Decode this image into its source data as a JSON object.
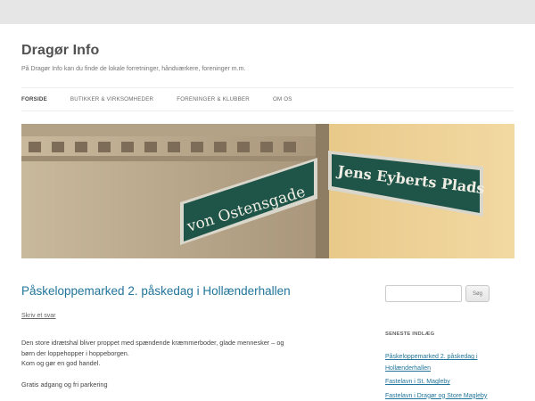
{
  "site": {
    "title": "Dragør Info",
    "description": "På Dragør Info kan du finde de lokale forretninger, håndværkere, foreninger m.m."
  },
  "nav": {
    "items": [
      {
        "label": "FORSIDE",
        "current": true
      },
      {
        "label": "BUTIKKER & VIRKSOMHEDER",
        "current": false
      },
      {
        "label": "FORENINGER & KLUBBER",
        "current": false
      },
      {
        "label": "OM OS",
        "current": false
      }
    ]
  },
  "banner": {
    "sign_left": "von Ostensgade",
    "sign_right": "Jens Eyberts Plads"
  },
  "post": {
    "title": "Påskeloppemarked 2. påskedag i Hollænderhallen",
    "comments_link": "Skriv et svar",
    "paragraph_1_line_1": "Den store idrætshal bliver proppet med spændende kræmmerboder, glade mennesker – og",
    "paragraph_1_line_2": "børn der loppehopper i hoppeborgen.",
    "paragraph_1_line_3": "Kom og gør en god handel.",
    "paragraph_2": "Gratis adgang og fri parkering"
  },
  "sidebar": {
    "search_value": "",
    "search_button": "Søg",
    "recent_title": "SENESTE INDLÆG",
    "recent_posts": [
      "Påskeloppemarked 2. påskedag i Hollænderhallen",
      "Fastelavn i St. Magleby",
      "Fastelavn i Dragør og Store Magleby"
    ]
  },
  "colors": {
    "link": "#21759b",
    "sign_bg": "#1f5448",
    "page_bg": "#e6e6e6"
  }
}
